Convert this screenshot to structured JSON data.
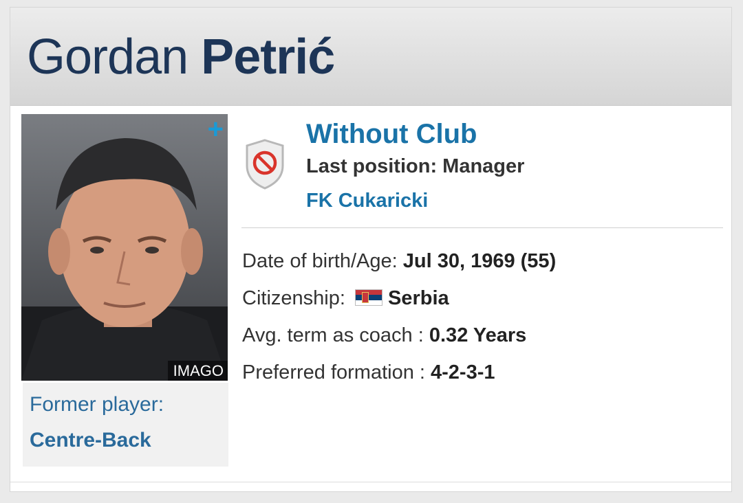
{
  "header": {
    "first_name": "Gordan",
    "last_name": "Petrić"
  },
  "photo": {
    "credit": "IMAGO",
    "add_icon": "plus-icon",
    "plus_symbol": "+"
  },
  "former": {
    "label": "Former player:",
    "position": "Centre-Back"
  },
  "status": {
    "icon": "prohibited-shield-icon",
    "title": "Without Club",
    "last_position": "Last position: Manager",
    "club": "FK Cukaricki"
  },
  "facts": {
    "dob_label": "Date of birth/Age:",
    "dob_value": "Jul 30, 1969 (55)",
    "citizenship_label": "Citizenship:",
    "citizenship_value": "Serbia",
    "citizenship_flag": "serbia-flag-icon",
    "term_label": "Avg. term as coach :",
    "term_value": "0.32 Years",
    "formation_label": "Preferred formation :",
    "formation_value": "4-2-3-1"
  },
  "colors": {
    "name": "#1d3557",
    "link": "#1a73a8",
    "accent": "#1a9ad6"
  }
}
